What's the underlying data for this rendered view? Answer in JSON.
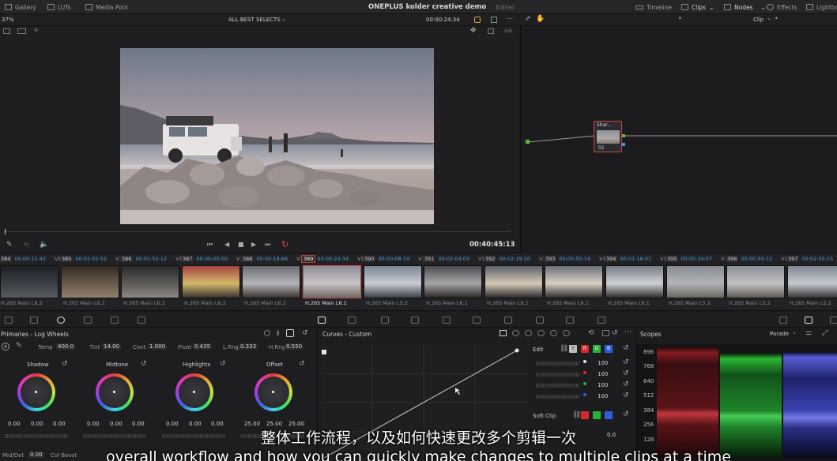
{
  "topbar": {
    "gallery": "Gallery",
    "luts": "LUTs",
    "media_pool": "Media Pool",
    "project_title": "ONEPLUS kolder creative demo",
    "edited": "Edited",
    "timeline": "Timeline",
    "clips": "Clips",
    "nodes": "Nodes",
    "effects": "Effects",
    "lightbox": "Lightbo"
  },
  "viewer": {
    "zoom": "37%",
    "mode": "ALL BEST SELECTS",
    "timecode_top": "00:00:24:34",
    "timecode_bottom": "00:40:45:13",
    "ab_label": "A/B"
  },
  "node_panel": {
    "mode": "Clip",
    "node_label": "Shar...",
    "node_number": "01"
  },
  "clips": [
    {
      "num": "384",
      "tc": "00:00:11:42",
      "track": "V1",
      "codec": "H.265 Main L6.2",
      "colors": [
        "#1d2024",
        "#3a3f45",
        "#575b60"
      ]
    },
    {
      "num": "385",
      "tc": "00:02:02:52",
      "track": "V1",
      "codec": "H.265 Main L6.2",
      "colors": [
        "#332a22",
        "#6a5a4c",
        "#94806c"
      ]
    },
    {
      "num": "386",
      "tc": "00:01:52:12",
      "track": "V1",
      "codec": "H.265 Main L6.2",
      "colors": [
        "#2a2a2c",
        "#5c5a57",
        "#8c8782"
      ]
    },
    {
      "num": "387",
      "tc": "00:00:00:00",
      "track": "V1",
      "codec": "H.265 Main L6.2",
      "colors": [
        "#a34240",
        "#d3b96a",
        "#3a3330"
      ]
    },
    {
      "num": "388",
      "tc": "00:00:18:86",
      "track": "V1",
      "codec": "H.265 Main L6.2",
      "colors": [
        "#6a6a72",
        "#b5b3b8",
        "#3a3533"
      ]
    },
    {
      "num": "389",
      "tc": "00:00:24:34",
      "track": "V1",
      "codec": "H.265 Main L6.1",
      "colors": [
        "#8c8a94",
        "#c9c4c6",
        "#6e6760"
      ]
    },
    {
      "num": "390",
      "tc": "00:00:08:19",
      "track": "V1",
      "codec": "H.265 Main L5.2",
      "colors": [
        "#7a8494",
        "#c9ccd2",
        "#3c4148"
      ]
    },
    {
      "num": "391",
      "tc": "00:02:04:03",
      "track": "V1",
      "codec": "H.265 Main L6.1",
      "colors": [
        "#4a4a4e",
        "#a7a6a8",
        "#2a2624"
      ]
    },
    {
      "num": "392",
      "tc": "00:02:19:20",
      "track": "V1",
      "codec": "H.265 Main L6.1",
      "colors": [
        "#5a6068",
        "#d6c9b6",
        "#2c2c2e"
      ]
    },
    {
      "num": "393",
      "tc": "00:00:50:19",
      "track": "V1",
      "codec": "H.265 Main L6.1",
      "colors": [
        "#6a6f78",
        "#d9d0c4",
        "#2e2d2d"
      ]
    },
    {
      "num": "394",
      "tc": "00:01:16:01",
      "track": "V1",
      "codec": "H.265 Main L6.1",
      "colors": [
        "#767b84",
        "#cfd1d4",
        "#2f2e2f"
      ]
    },
    {
      "num": "395",
      "tc": "00:00:34:07",
      "track": "V1",
      "codec": "H.265 Main L5.2",
      "colors": [
        "#878b92",
        "#b4b4b6",
        "#6a6762"
      ]
    },
    {
      "num": "396",
      "tc": "00:00:50:12",
      "track": "V1",
      "codec": "H.265 Main L5.2",
      "colors": [
        "#8b8f96",
        "#c2c1c2",
        "#5e5a56"
      ]
    },
    {
      "num": "397",
      "tc": "00:02:55:15",
      "track": "V1",
      "codec": "H.265 Main L5.2",
      "colors": [
        "#7f8793",
        "#c6c9cd",
        "#38383a"
      ]
    }
  ],
  "primaries": {
    "title": "Primaries - Log Wheels",
    "temp_label": "Temp",
    "temp": "400.0",
    "tint_label": "Tint",
    "tint": "14.00",
    "cont_label": "Cont",
    "cont": "1.000",
    "pivot_label": "Pivot",
    "pivot": "0.435",
    "lrng_label": "L.Rng",
    "lrng": "0.333",
    "hrng_label": "H.Rng",
    "hrng": "0.550",
    "wheels": [
      {
        "name": "Shadow",
        "values": [
          "0.00",
          "0.00",
          "0.00"
        ]
      },
      {
        "name": "Midtone",
        "values": [
          "0.00",
          "0.00",
          "0.00"
        ]
      },
      {
        "name": "Highlights",
        "values": [
          "0.00",
          "0.00",
          "0.00"
        ]
      },
      {
        "name": "Offset",
        "values": [
          "25.00",
          "25.00",
          "25.00"
        ]
      }
    ],
    "middet_label": "Mid/Det",
    "middet": "0.00",
    "colboost_label": "Col Boost"
  },
  "curves": {
    "title": "Curves - Custom",
    "edit_label": "Edit",
    "y_label": "Y",
    "r_label": "R",
    "g_label": "G",
    "b_label": "B",
    "intensity": [
      "100",
      "100",
      "100",
      "100"
    ],
    "softclip_label": "Soft Clip",
    "softclip_value": "0.0"
  },
  "scopes": {
    "title": "Scopes",
    "mode": "Parade",
    "ticks": [
      "896",
      "768",
      "640",
      "512",
      "384",
      "256",
      "128"
    ]
  },
  "subtitles": {
    "cn": "整体工作流程，以及如何快速更改多个剪辑一次",
    "en": "overall workflow and how you can quickly make changes to multiple clips at a time"
  },
  "colors": {
    "accent_blue": "#4ea0e0",
    "selected_red": "#c8484a",
    "channel_red": "#d8282e",
    "channel_green": "#27b23c",
    "channel_blue": "#2f5fe0"
  }
}
